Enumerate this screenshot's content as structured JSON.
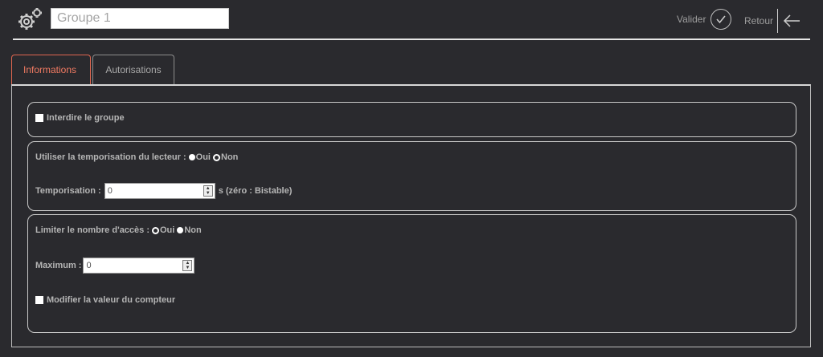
{
  "header": {
    "group_name": "Groupe 1",
    "valider_label": "Valider",
    "retour_label": "Retour"
  },
  "tabs": [
    {
      "label": "Informations",
      "active": true
    },
    {
      "label": "Autorisations",
      "active": false
    }
  ],
  "section1": {
    "forbid_label": "Interdire le groupe",
    "forbid_checked": false
  },
  "section2": {
    "use_delay_label": "Utiliser la temporisation du lecteur :",
    "oui_label": "Oui",
    "non_label": "Non",
    "selected": "Non",
    "delay_label": "Temporisation :",
    "delay_value": "0",
    "delay_hint": "s (zéro : Bistable)"
  },
  "section3": {
    "limit_label": "Limiter le nombre d'accès :",
    "oui_label": "Oui",
    "non_label": "Non",
    "selected": "Oui",
    "max_label": "Maximum :",
    "max_value": "0",
    "modify_label": "Modifier la valeur du compteur",
    "modify_checked": false
  },
  "colors": {
    "background": "#2a2a2e",
    "active_tab": "#f07a62"
  }
}
